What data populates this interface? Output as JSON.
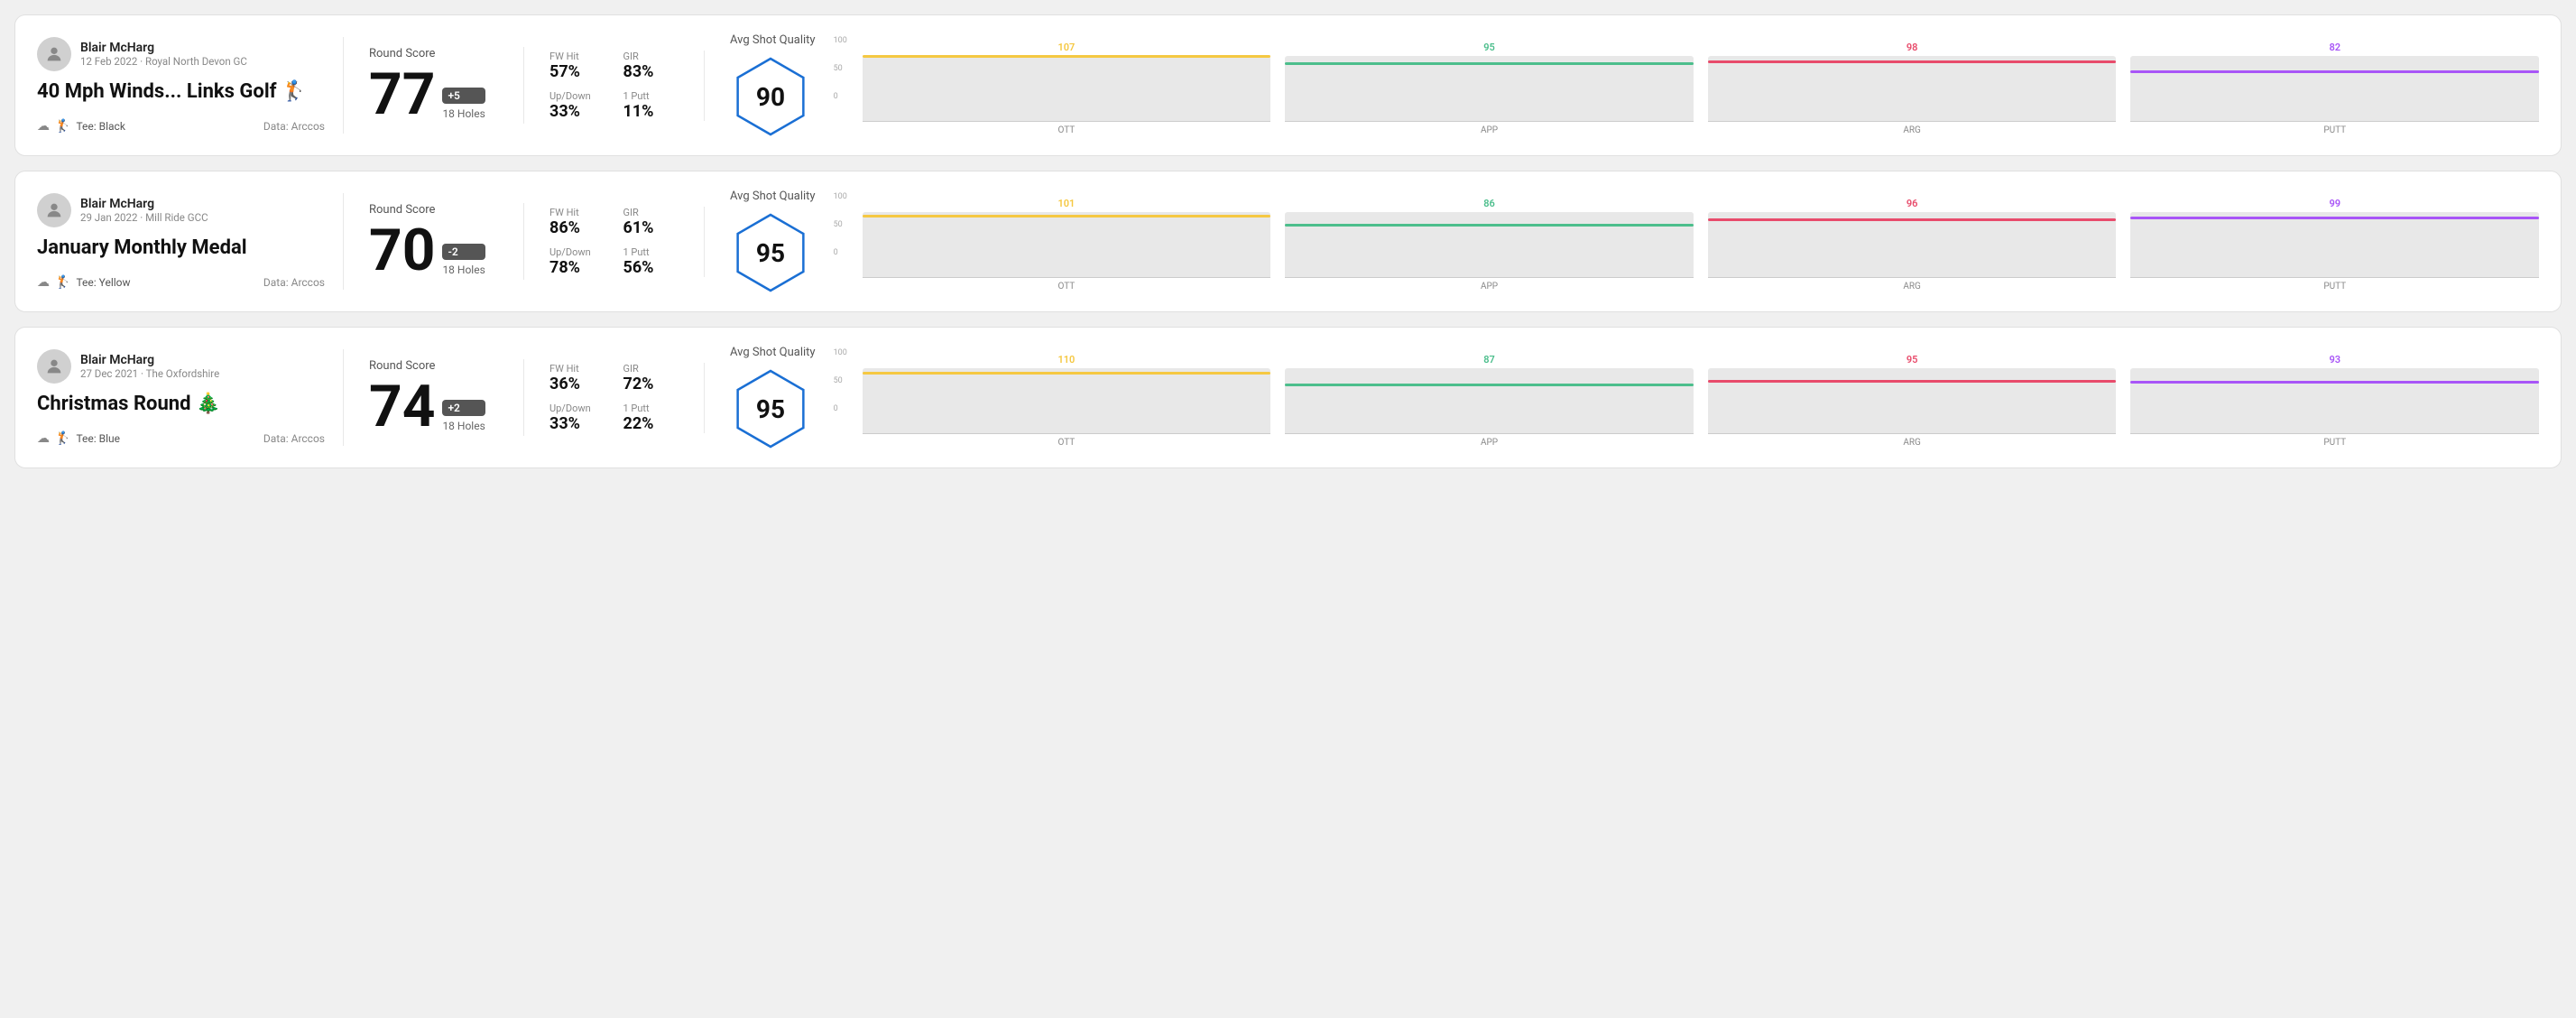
{
  "rounds": [
    {
      "id": "round1",
      "user": {
        "name": "Blair McHarg",
        "date": "12 Feb 2022",
        "course": "Royal North Devon GC"
      },
      "title": "40 Mph Winds... Links Golf 🏌️",
      "tee": "Black",
      "data_source": "Data: Arccos",
      "score": {
        "label": "Round Score",
        "number": "77",
        "modifier": "+5",
        "holes": "18 Holes"
      },
      "stats": {
        "fw_hit_label": "FW Hit",
        "fw_hit_value": "57%",
        "gir_label": "GIR",
        "gir_value": "83%",
        "updown_label": "Up/Down",
        "updown_value": "33%",
        "oneputt_label": "1 Putt",
        "oneputt_value": "11%"
      },
      "quality": {
        "label": "Avg Shot Quality",
        "score": "90"
      },
      "chart": {
        "bars": [
          {
            "label": "OTT",
            "value": 107,
            "color": "#f5c842"
          },
          {
            "label": "APP",
            "value": 95,
            "color": "#4cbe8c"
          },
          {
            "label": "ARG",
            "value": 98,
            "color": "#e84b6b"
          },
          {
            "label": "PUTT",
            "value": 82,
            "color": "#a855f7"
          }
        ],
        "y_max": 110
      }
    },
    {
      "id": "round2",
      "user": {
        "name": "Blair McHarg",
        "date": "29 Jan 2022",
        "course": "Mill Ride GCC"
      },
      "title": "January Monthly Medal",
      "tee": "Yellow",
      "data_source": "Data: Arccos",
      "score": {
        "label": "Round Score",
        "number": "70",
        "modifier": "-2",
        "holes": "18 Holes"
      },
      "stats": {
        "fw_hit_label": "FW Hit",
        "fw_hit_value": "86%",
        "gir_label": "GIR",
        "gir_value": "61%",
        "updown_label": "Up/Down",
        "updown_value": "78%",
        "oneputt_label": "1 Putt",
        "oneputt_value": "56%"
      },
      "quality": {
        "label": "Avg Shot Quality",
        "score": "95"
      },
      "chart": {
        "bars": [
          {
            "label": "OTT",
            "value": 101,
            "color": "#f5c842"
          },
          {
            "label": "APP",
            "value": 86,
            "color": "#4cbe8c"
          },
          {
            "label": "ARG",
            "value": 96,
            "color": "#e84b6b"
          },
          {
            "label": "PUTT",
            "value": 99,
            "color": "#a855f7"
          }
        ],
        "y_max": 110
      }
    },
    {
      "id": "round3",
      "user": {
        "name": "Blair McHarg",
        "date": "27 Dec 2021",
        "course": "The Oxfordshire"
      },
      "title": "Christmas Round 🎄",
      "tee": "Blue",
      "data_source": "Data: Arccos",
      "score": {
        "label": "Round Score",
        "number": "74",
        "modifier": "+2",
        "holes": "18 Holes"
      },
      "stats": {
        "fw_hit_label": "FW Hit",
        "fw_hit_value": "36%",
        "gir_label": "GIR",
        "gir_value": "72%",
        "updown_label": "Up/Down",
        "updown_value": "33%",
        "oneputt_label": "1 Putt",
        "oneputt_value": "22%"
      },
      "quality": {
        "label": "Avg Shot Quality",
        "score": "95"
      },
      "chart": {
        "bars": [
          {
            "label": "OTT",
            "value": 110,
            "color": "#f5c842"
          },
          {
            "label": "APP",
            "value": 87,
            "color": "#4cbe8c"
          },
          {
            "label": "ARG",
            "value": 95,
            "color": "#e84b6b"
          },
          {
            "label": "PUTT",
            "value": 93,
            "color": "#a855f7"
          }
        ],
        "y_max": 120
      }
    }
  ],
  "y_axis_labels": [
    "100",
    "50",
    "0"
  ]
}
